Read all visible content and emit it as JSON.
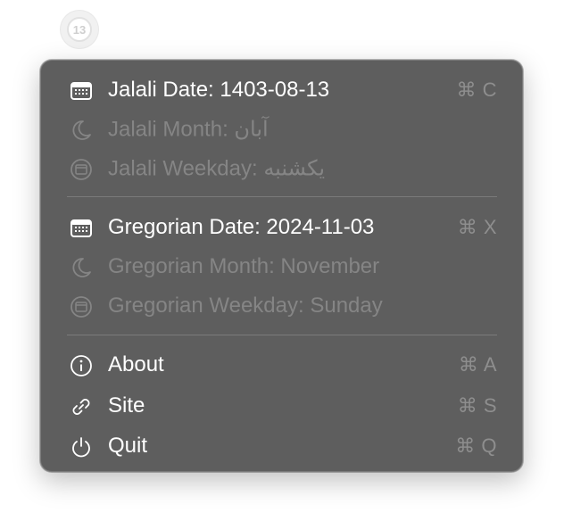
{
  "tray": {
    "badge_number": "13"
  },
  "menu": {
    "jalali": {
      "date": {
        "label": "Jalali Date: 1403-08-13",
        "shortcut": "⌘ C",
        "icon": "calendar-icon"
      },
      "month": {
        "label": "Jalali Month: آبان",
        "icon": "moon-icon"
      },
      "weekday": {
        "label": "Jalali Weekday: یکشنبه",
        "icon": "calendar-circle-icon"
      }
    },
    "gregorian": {
      "date": {
        "label": "Gregorian Date: 2024-11-03",
        "shortcut": "⌘ X",
        "icon": "calendar-icon"
      },
      "month": {
        "label": "Gregorian Month: November",
        "icon": "moon-icon"
      },
      "weekday": {
        "label": "Gregorian Weekday: Sunday",
        "icon": "calendar-circle-icon"
      }
    },
    "actions": {
      "about": {
        "label": "About",
        "shortcut": "⌘ A",
        "icon": "info-icon"
      },
      "site": {
        "label": "Site",
        "shortcut": "⌘ S",
        "icon": "link-icon"
      },
      "quit": {
        "label": "Quit",
        "shortcut": "⌘ Q",
        "icon": "power-icon"
      }
    }
  },
  "colors": {
    "menu_background": "#5e5e5e",
    "enabled_text": "#ffffff",
    "disabled_text": "#858585",
    "shortcut_text": "#8e8e8e"
  }
}
